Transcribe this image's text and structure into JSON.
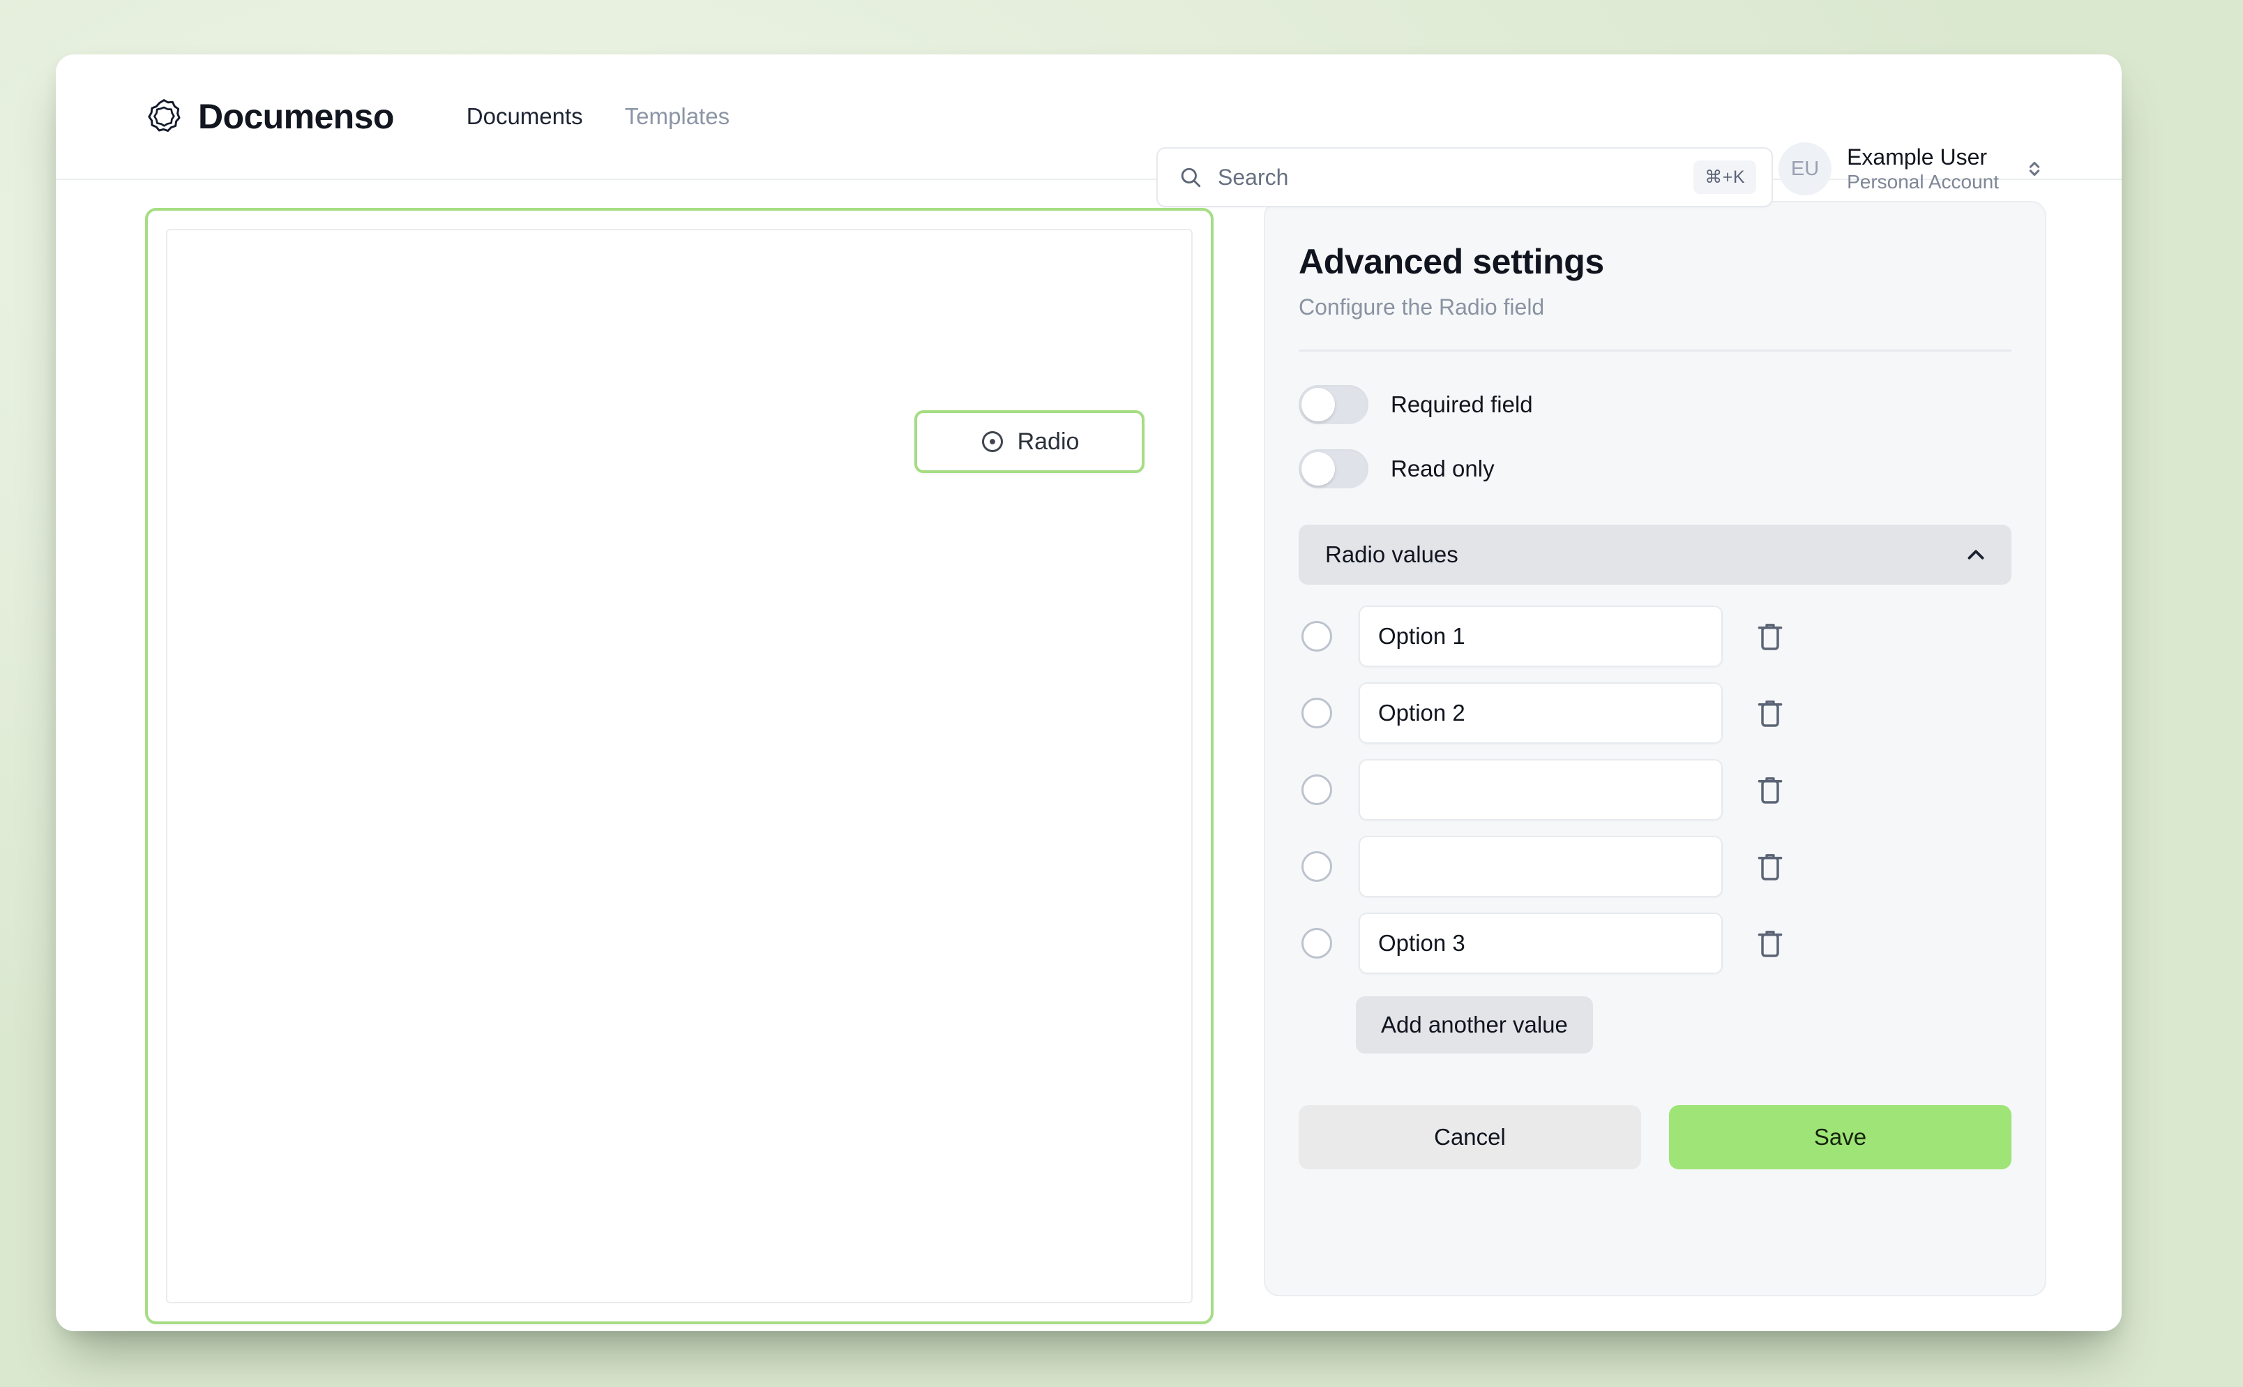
{
  "app": {
    "brand_name": "Documenso",
    "brand_logo_icon": "documenso-flower-logo-icon"
  },
  "nav": {
    "items": [
      {
        "label": "Documents",
        "active": true
      },
      {
        "label": "Templates",
        "active": false
      }
    ]
  },
  "search": {
    "placeholder": "Search",
    "icon": "search-icon",
    "shortcut": "⌘+K"
  },
  "account": {
    "initials": "EU",
    "name": "Example User",
    "subtitle": "Personal Account",
    "icon": "chevrons-up-down-icon"
  },
  "document": {
    "field": {
      "label": "Radio",
      "icon": "radio-circle-icon"
    }
  },
  "panel": {
    "title": "Advanced settings",
    "subtitle": "Configure the Radio field",
    "toggles": [
      {
        "label": "Required field",
        "checked": false
      },
      {
        "label": "Read only",
        "checked": false
      }
    ],
    "accordion": {
      "label": "Radio values",
      "icon": "chevron-up-icon",
      "expanded": true
    },
    "options": [
      {
        "value": "Option 1",
        "selected": false
      },
      {
        "value": "Option 2",
        "selected": false
      },
      {
        "value": "",
        "selected": false
      },
      {
        "value": "",
        "selected": false
      },
      {
        "value": "Option 3",
        "selected": false
      }
    ],
    "add_value_label": "Add another value",
    "cancel_label": "Cancel",
    "save_label": "Save"
  },
  "colors": {
    "accent_green": "#9fe476",
    "field_border_green": "#a6dd84",
    "panel_bg": "#f6f7f8",
    "text_dark": "#11151f",
    "text_muted": "#8a93a2"
  }
}
